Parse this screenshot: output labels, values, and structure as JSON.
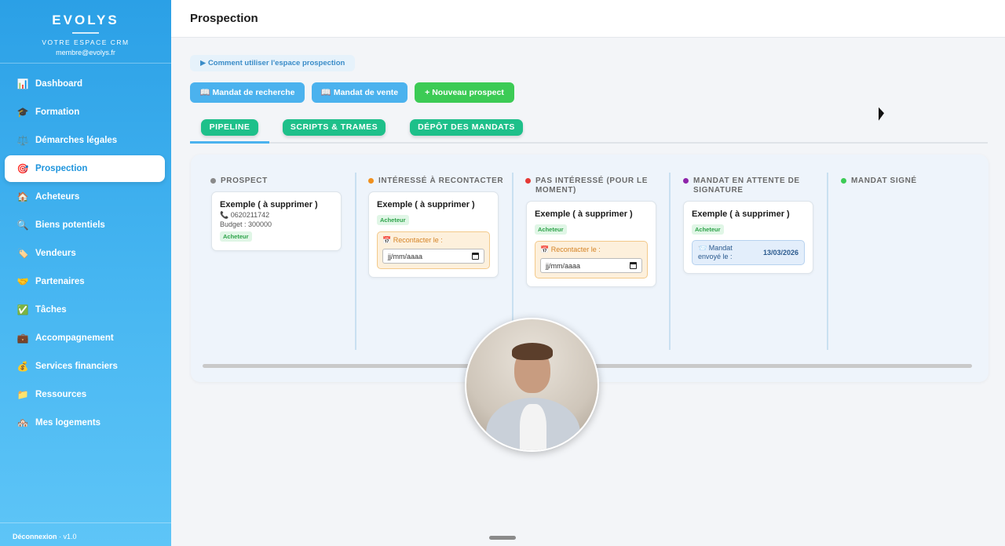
{
  "brand": {
    "title": "EVOLYS",
    "subtitle": "VOTRE ESPACE CRM",
    "email": "membre@evolys.fr"
  },
  "sidebar": {
    "items": [
      {
        "label": "Dashboard",
        "icon": "📊"
      },
      {
        "label": "Formation",
        "icon": "🎓"
      },
      {
        "label": "Démarches légales",
        "icon": "⚖️"
      },
      {
        "label": "Prospection",
        "icon": "🎯"
      },
      {
        "label": "Acheteurs",
        "icon": "🏠"
      },
      {
        "label": "Biens potentiels",
        "icon": "🔍"
      },
      {
        "label": "Vendeurs",
        "icon": "🏷️"
      },
      {
        "label": "Partenaires",
        "icon": "🤝"
      },
      {
        "label": "Tâches",
        "icon": "✅"
      },
      {
        "label": "Accompagnement",
        "icon": "💼"
      },
      {
        "label": "Services financiers",
        "icon": "💰"
      },
      {
        "label": "Ressources",
        "icon": "📁"
      },
      {
        "label": "Mes logements",
        "icon": "🏘️"
      }
    ],
    "active": "Prospection",
    "footer": {
      "logout": "Déconnexion",
      "version": " · v1.0"
    }
  },
  "header": {
    "title": "Prospection"
  },
  "help_link": "▶ Comment utiliser l'espace prospection",
  "actions": {
    "mandat_recherche": "📖 Mandat de recherche",
    "mandat_vente": "📖 Mandat de vente",
    "nouveau_prospect": "+ Nouveau prospect"
  },
  "tabs": [
    "PIPELINE",
    "SCRIPTS & TRAMES",
    "DÉPÔT DES MANDATS"
  ],
  "pipeline": {
    "columns": [
      {
        "title": "PROSPECT",
        "color": "#8a8a8a"
      },
      {
        "title": "INTÉRESSÉ À RECONTACTER",
        "color": "#f0901e"
      },
      {
        "title_line1": "PAS INTÉRESSÉ (POUR LE",
        "title_line2": "MOMENT)",
        "color": "#e53935"
      },
      {
        "title_line1": "MANDAT EN ATTENTE DE",
        "title_line2": "SIGNATURE",
        "color": "#8e24aa"
      },
      {
        "title": "MANDAT SIGNÉ",
        "color": "#3ccb55"
      }
    ],
    "cards": {
      "prospect": {
        "title": "Exemple ( à supprimer )",
        "phone": "📞 0620211742",
        "budget": "Budget : 300000",
        "badge": "Acheteur"
      },
      "interesse": {
        "title": "Exemple ( à supprimer )",
        "badge": "Acheteur",
        "recontact_label": "📅 Recontacter le :",
        "date_placeholder": "jj/mm/aaaa"
      },
      "pas_interesse": {
        "title": "Exemple ( à supprimer )",
        "badge": "Acheteur",
        "recontact_label": "📅 Recontacter le :",
        "date_placeholder": "jj/mm/aaaa"
      },
      "attente": {
        "title": "Exemple ( à supprimer )",
        "badge": "Acheteur",
        "mandat_label_1": "📨 Mandat",
        "mandat_label_2": "envoyé le :",
        "mandat_date": "13/03/2026"
      }
    }
  }
}
